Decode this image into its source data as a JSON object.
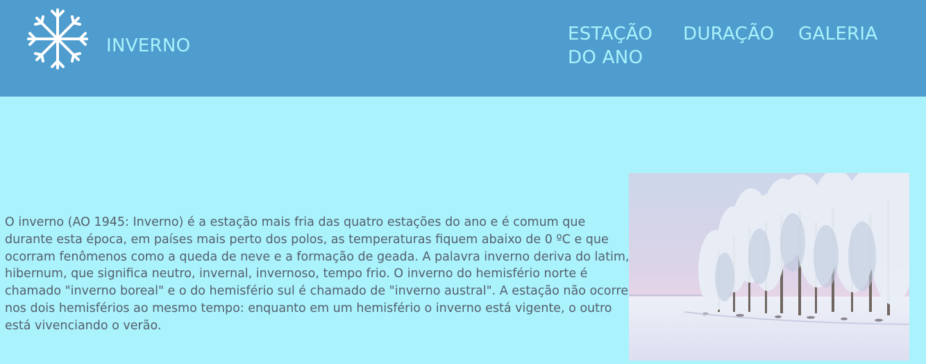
{
  "header": {
    "brand": "INVERNO",
    "nav": [
      {
        "label": "ESTAÇÃO DO ANO"
      },
      {
        "label": "DURAÇÃO"
      },
      {
        "label": "GALERIA"
      }
    ]
  },
  "main": {
    "paragraph": "O inverno (AO 1945: Inverno) é a estação mais fria das quatro estações do ano e é comum que durante esta época, em países mais perto dos polos, as temperaturas fiquem abaixo de 0 ºC e que ocorram fenômenos como a queda de neve e a formação de geada. A palavra inverno deriva do latim, hibernum, que significa neutro, invernal, invernoso, tempo frio. O inverno do hemisfério norte é chamado \"inverno boreal\" e o do hemisfério sul é chamado de \"inverno austral\". A estação não ocorre nos dois hemisférios ao mesmo tempo: enquanto em um hemisfério o inverno está vigente, o outro está vivenciando o verão."
  },
  "icons": {
    "logo": "snowflake-icon"
  },
  "colors": {
    "header_bg": "#4f9dce",
    "page_bg": "#aaf2fc",
    "accent_text": "#aaf2fc",
    "body_text": "#54606c"
  }
}
